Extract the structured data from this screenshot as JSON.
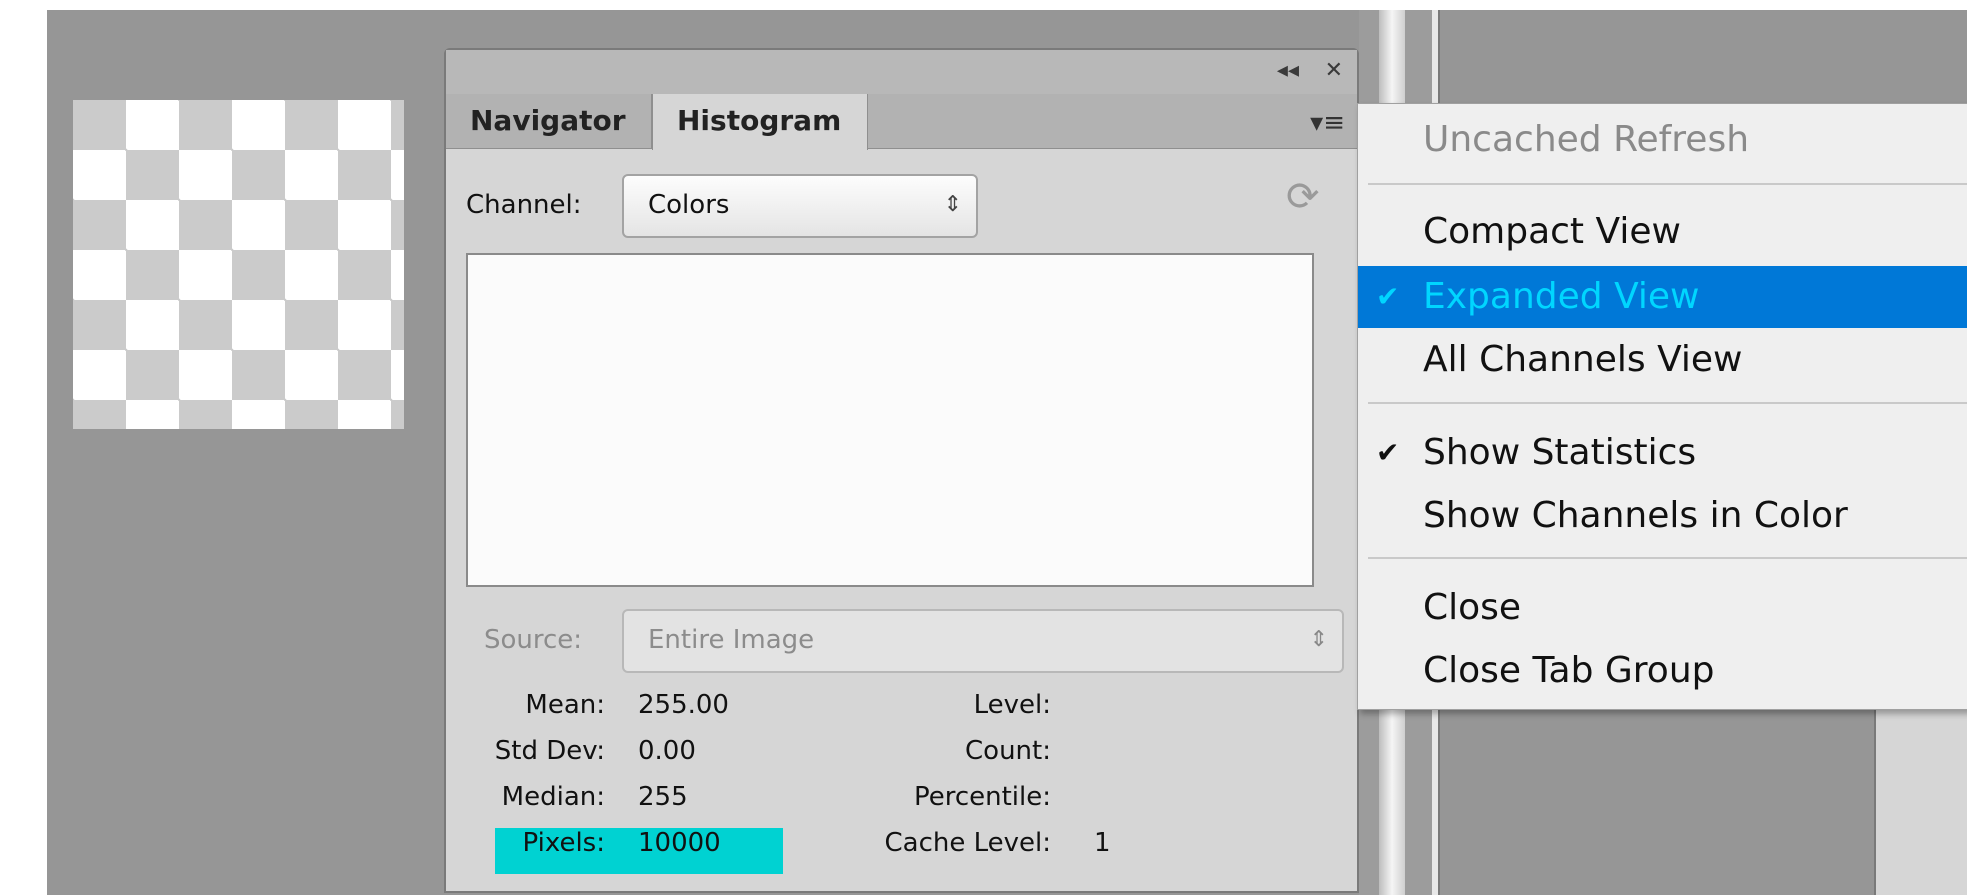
{
  "panel": {
    "tabs": [
      "Navigator",
      "Histogram"
    ],
    "collapse_icon": "double-chevron-left-icon",
    "close_icon": "close-icon",
    "menu_icon": "panel-menu-icon",
    "channel_label": "Channel:",
    "channel_value": "Colors",
    "source_label": "Source:",
    "source_value": "Entire Image",
    "refresh_icon": "refresh-icon"
  },
  "stats": {
    "mean_label": "Mean:",
    "mean": "255.00",
    "stddev_label": "Std Dev:",
    "stddev": "0.00",
    "median_label": "Median:",
    "median": "255",
    "pixels_label": "Pixels:",
    "pixels": "10000",
    "level_label": "Level:",
    "level": "",
    "count_label": "Count:",
    "count": "",
    "percentile_label": "Percentile:",
    "percentile": "",
    "cache_label": "Cache Level:",
    "cache": "1"
  },
  "menu": {
    "uncached_refresh": "Uncached Refresh",
    "compact_view": "Compact View",
    "expanded_view": "Expanded View",
    "all_channels_view": "All Channels View",
    "show_statistics": "Show Statistics",
    "show_channels_color": "Show Channels in Color",
    "close": "Close",
    "close_tab_group": "Close Tab Group"
  },
  "colors": {
    "selection": "#0078d7",
    "highlight": "#00d2d2",
    "workspace": "#969696"
  }
}
